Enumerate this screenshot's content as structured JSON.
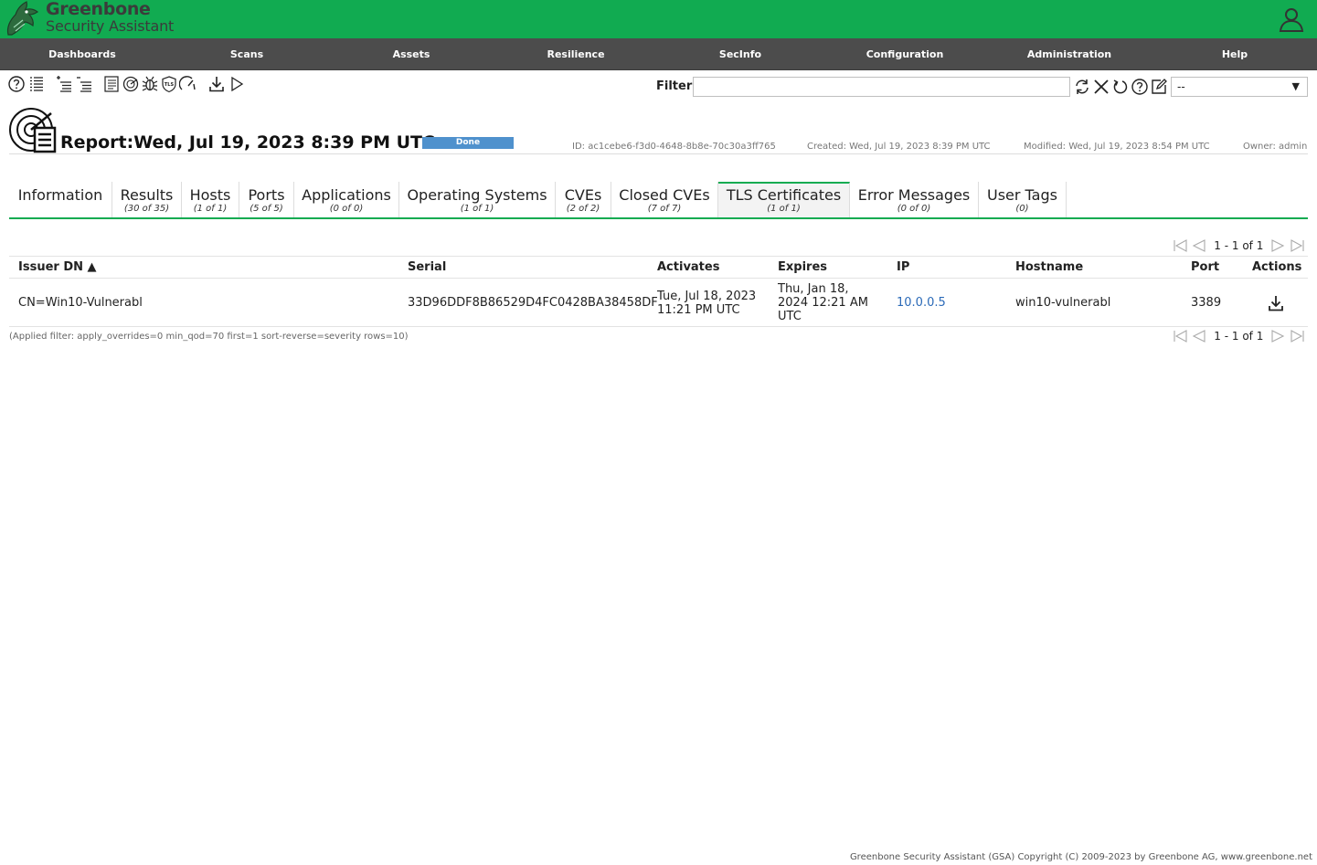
{
  "app": {
    "brand_line1": "Greenbone",
    "brand_line2": "Security Assistant"
  },
  "nav": {
    "items": [
      {
        "label": "Dashboards"
      },
      {
        "label": "Scans"
      },
      {
        "label": "Assets"
      },
      {
        "label": "Resilience"
      },
      {
        "label": "SecInfo"
      },
      {
        "label": "Configuration"
      },
      {
        "label": "Administration"
      },
      {
        "label": "Help"
      }
    ]
  },
  "toolbar": {
    "icons": [
      "help-icon",
      "list-icon",
      "add-to-assets-icon",
      "remove-from-assets-icon",
      "task-list-icon",
      "results-icon",
      "vulnerabilities-icon",
      "tls-shield-icon",
      "performance-icon",
      "download-icon",
      "start-icon"
    ]
  },
  "filter": {
    "label": "Filter",
    "value": "",
    "select_value": "--"
  },
  "report": {
    "title": "Report:Wed, Jul 19, 2023 8:39 PM UTC",
    "status": "Done",
    "id": "ID: ac1cebe6-f3d0-4648-8b8e-70c30a3ff765",
    "created": "Created: Wed, Jul 19, 2023 8:39 PM UTC",
    "modified": "Modified: Wed, Jul 19, 2023 8:54 PM UTC",
    "owner": "Owner: admin"
  },
  "tabs": [
    {
      "label": "Information",
      "count": ""
    },
    {
      "label": "Results",
      "count": "(30 of 35)"
    },
    {
      "label": "Hosts",
      "count": "(1 of 1)"
    },
    {
      "label": "Ports",
      "count": "(5 of 5)"
    },
    {
      "label": "Applications",
      "count": "(0 of 0)"
    },
    {
      "label": "Operating Systems",
      "count": "(1 of 1)"
    },
    {
      "label": "CVEs",
      "count": "(2 of 2)"
    },
    {
      "label": "Closed CVEs",
      "count": "(7 of 7)"
    },
    {
      "label": "TLS Certificates",
      "count": "(1 of 1)"
    },
    {
      "label": "Error Messages",
      "count": "(0 of 0)"
    },
    {
      "label": "User Tags",
      "count": "(0)"
    }
  ],
  "pagination": {
    "text": "1 - 1 of 1"
  },
  "table": {
    "columns": [
      "Issuer DN ▲",
      "Serial",
      "Activates",
      "Expires",
      "IP",
      "Hostname",
      "Port",
      "Actions"
    ],
    "rows": [
      {
        "issuer_dn": "CN=Win10-Vulnerabl",
        "serial": "33D96DDF8B86529D4FC0428BA38458DF",
        "activates_line1": "Tue, Jul 18, 2023",
        "activates_line2": "11:21 PM UTC",
        "expires_line1": "Thu, Jan 18,",
        "expires_line2": "2024 12:21 AM",
        "expires_line3": "UTC",
        "ip": "10.0.0.5",
        "hostname": "win10-vulnerabl",
        "port": "3389"
      }
    ]
  },
  "applied_filter": "(Applied filter: apply_overrides=0 min_qod=70 first=1 sort-reverse=severity rows=10)",
  "footer": "Greenbone Security Assistant (GSA) Copyright (C) 2009-2023 by Greenbone AG, www.greenbone.net",
  "colors": {
    "brand_green": "#11ab51",
    "nav_dark": "#4c4c4c",
    "status_blue": "#4f91cd",
    "link_blue": "#2b6ab8"
  }
}
